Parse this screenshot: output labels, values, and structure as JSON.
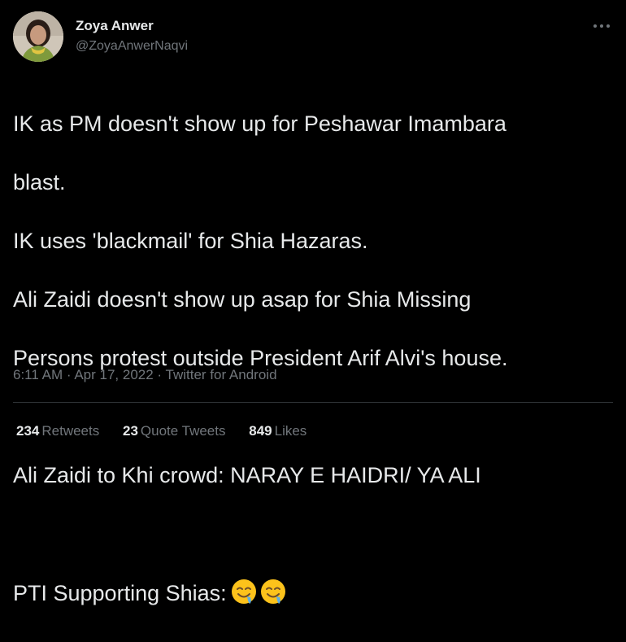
{
  "author": {
    "name": "Zoya Anwer",
    "handle": "@ZoyaAnwerNaqvi"
  },
  "tweet": {
    "lines": [
      "IK as PM doesn't show up for Peshawar Imambara",
      "blast.",
      "IK uses 'blackmail' for Shia Hazaras.",
      "Ali Zaidi doesn't show up asap for Shia Missing",
      "Persons protest outside President Arif Alvi's house.",
      "Ali Zaidi to Khi crowd: NARAY E HAIDRI/ YA ALI",
      "PTI Supporting Shias:"
    ],
    "emoji_icons": [
      "drooling-face-icon",
      "drooling-face-icon"
    ]
  },
  "meta": {
    "time": "6:11 AM",
    "separator": "·",
    "date": "Apr 17, 2022",
    "source": "Twitter for Android"
  },
  "stats": {
    "retweets_count": "234",
    "retweets_label": "Retweets",
    "quotes_count": "23",
    "quotes_label": "Quote Tweets",
    "likes_count": "849",
    "likes_label": "Likes"
  },
  "icons": {
    "more": "more-horizontal-icon"
  },
  "colors": {
    "background": "#000000",
    "text_primary": "#e7e9ea",
    "text_secondary": "#71767b",
    "divider": "#2f3336"
  }
}
